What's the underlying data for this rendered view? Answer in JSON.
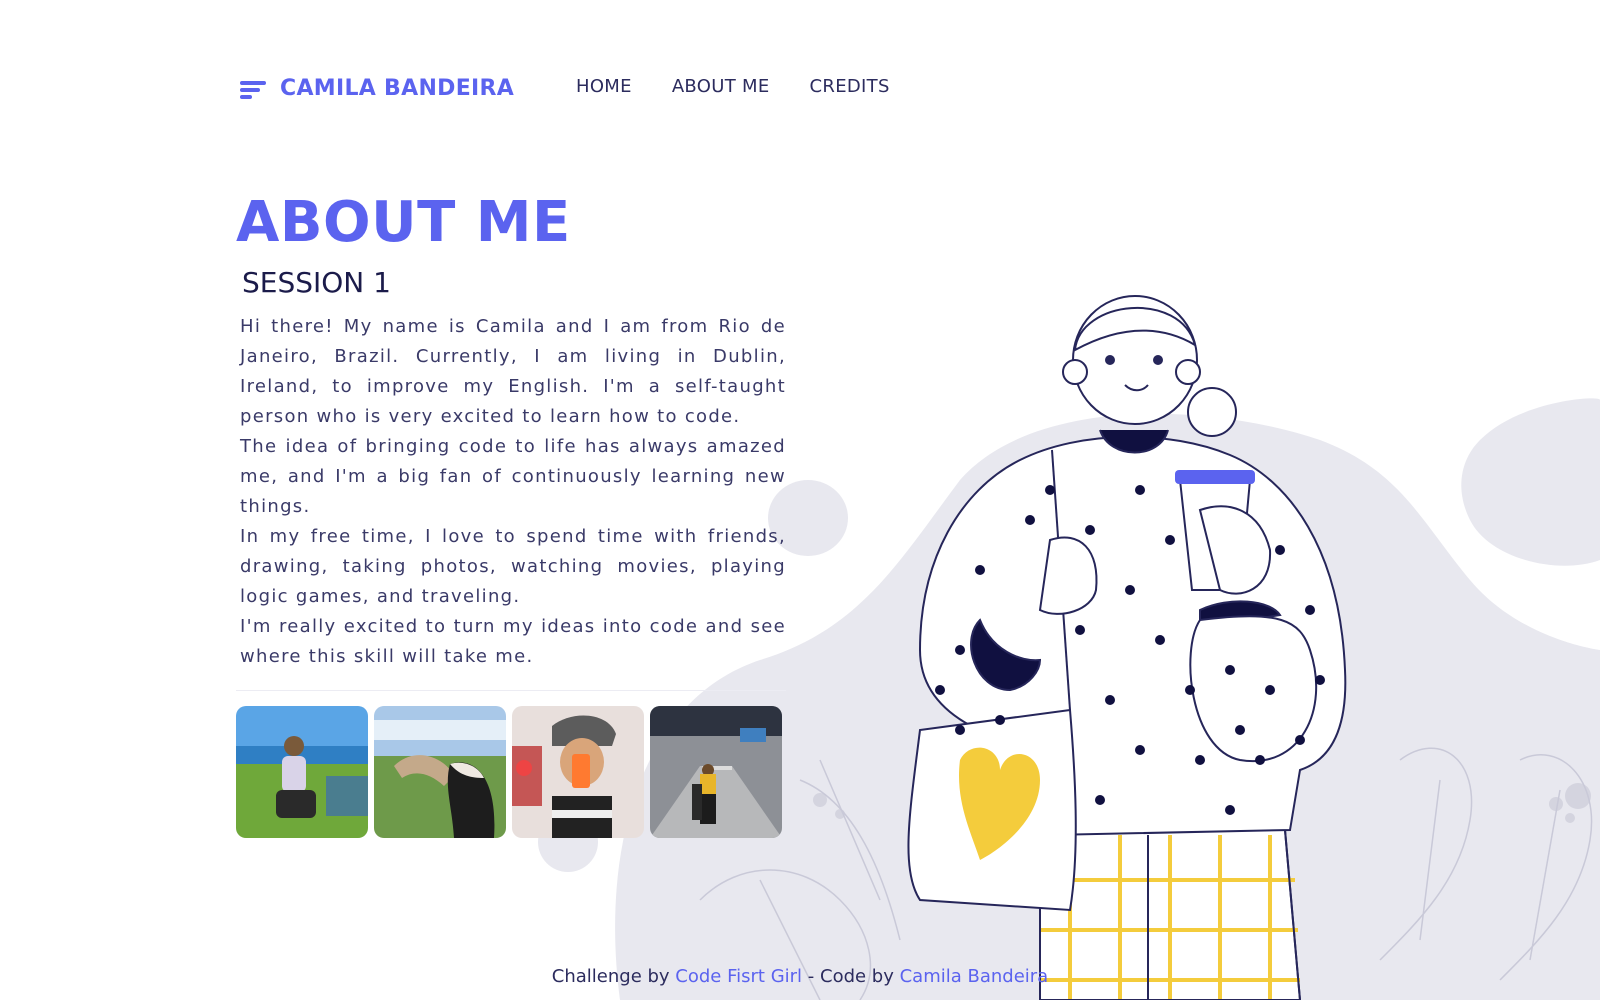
{
  "header": {
    "brand_name": "CAMILA BANDEIRA",
    "brand_icon": "menu-lines-icon",
    "nav": [
      {
        "label": "HOME"
      },
      {
        "label": "ABOUT ME"
      },
      {
        "label": "CREDITS"
      }
    ]
  },
  "main": {
    "title": "ABOUT ME",
    "subtitle": "SESSION 1",
    "paragraphs": [
      "Hi there! My name is Camila and I am from Rio de Janeiro, Brazil. Currently, I am living in Dublin, Ireland, to improve my English. I'm a self-taught person who is very excited to learn how to code.",
      "The idea of bringing code to life has always amazed me, and I'm a big fan of continuously learning new things.",
      "In my free time, I love to spend time with friends, drawing, taking photos, watching movies, playing logic games, and traveling.",
      "I'm really excited to turn my ideas into code and see where this skill will take me."
    ],
    "photos": [
      {
        "name": "photo-seaside"
      },
      {
        "name": "photo-horse"
      },
      {
        "name": "photo-selfie"
      },
      {
        "name": "photo-airport"
      }
    ]
  },
  "footer": {
    "prefix": "Challenge by ",
    "challenge_link": "Code Fisrt Girl",
    "middle": " - Code by ",
    "author_link": "Camila Bandeira"
  },
  "colors": {
    "accent": "#5b63ef",
    "text": "#2c2c5e",
    "blob": "#e8e8ef",
    "yellow": "#f4cc3c"
  }
}
